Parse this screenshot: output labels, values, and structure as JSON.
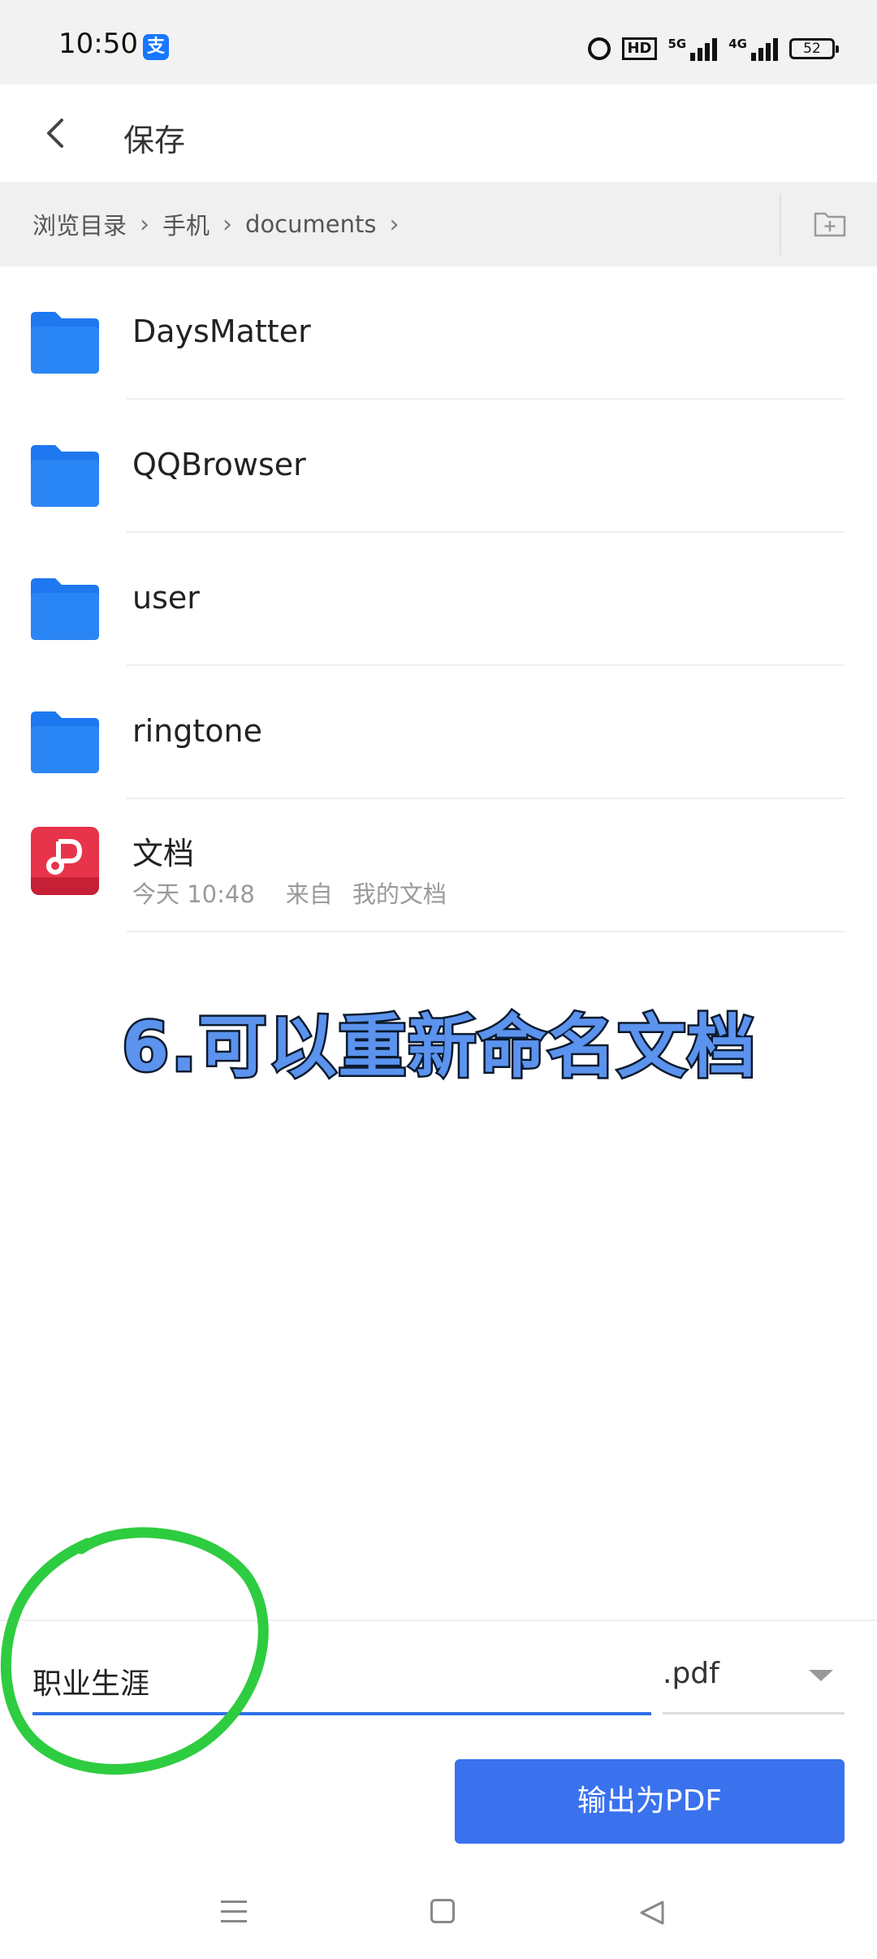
{
  "status_bar": {
    "time": "10:50",
    "app_badge": "支",
    "hd_label": "HD",
    "signal1_label": "5G",
    "signal2_label": "4G",
    "battery": "52"
  },
  "header": {
    "title": "保存"
  },
  "breadcrumb": {
    "items": [
      "浏览目录",
      "手机",
      "documents"
    ]
  },
  "list": {
    "folders": [
      {
        "name": "DaysMatter"
      },
      {
        "name": "QQBrowser"
      },
      {
        "name": "user"
      },
      {
        "name": "ringtone"
      }
    ],
    "file": {
      "name": "文档",
      "date": "今天 10:48",
      "from_label": "来自",
      "source": "我的文档"
    }
  },
  "overlay_caption": "6.可以重新命名文档",
  "save_form": {
    "filename_value": "职业生涯",
    "extension": ".pdf",
    "export_label": "输出为PDF"
  },
  "colors": {
    "accent": "#3a72ee",
    "folder": "#1e78f0",
    "annotation": "#2ecc40"
  },
  "icons": {
    "back": "chevron-left",
    "new_folder": "folder-plus",
    "folder": "folder",
    "wps": "wps-pdf",
    "dropdown": "triangle-down"
  }
}
